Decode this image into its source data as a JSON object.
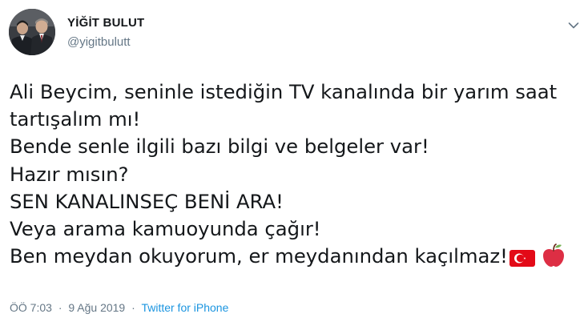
{
  "author": {
    "name": "YİĞİT BULUT",
    "handle": "@yigitbulutt"
  },
  "tweet": {
    "lines": [
      "Ali Beycim, seninle istediğin TV kanalında bir yarım saat",
      "tartışalım mı!",
      "Bende senle ilgili bazı bilgi ve belgeler var!",
      "Hazır mısın?",
      "SEN KANALINSEÇ BENİ ARA!",
      "Veya arama kamuoyunda çağır!",
      "Ben meydan okuyorum, er meydanından kaçılmaz!"
    ],
    "trailing_emojis": [
      "turkey-flag-icon",
      "red-apple-icon"
    ]
  },
  "meta": {
    "time": "ÖÖ 7:03",
    "separator": "·",
    "date": "9 Ağu 2019",
    "source": "Twitter for iPhone"
  },
  "colors": {
    "text": "#14171a",
    "secondary": "#657786",
    "link": "#1b95e0",
    "flag_red": "#e30a17",
    "apple_red": "#dd2e44"
  }
}
